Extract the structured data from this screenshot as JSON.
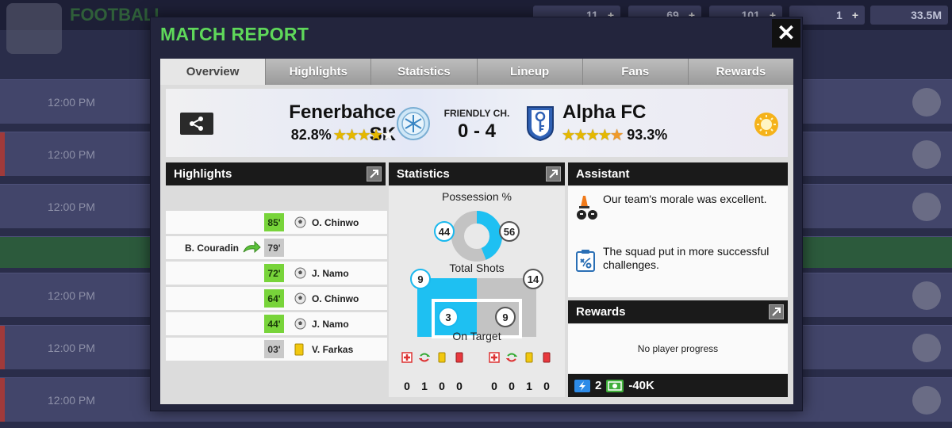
{
  "background": {
    "title": "FOOTBALL",
    "resources": [
      {
        "value": "11"
      },
      {
        "value": "69"
      },
      {
        "value": "101"
      },
      {
        "value": "1"
      },
      {
        "value": "33.5M"
      }
    ],
    "rows": [
      "12:00 PM",
      "12:00 PM",
      "12:00 PM",
      "12:00 PM",
      "12:00 PM",
      "12:00 PM"
    ]
  },
  "modal": {
    "title": "MATCH REPORT",
    "close_label": "✕"
  },
  "tabs": [
    "Overview",
    "Highlights",
    "Statistics",
    "Lineup",
    "Fans",
    "Rewards"
  ],
  "active_tab": "Overview",
  "match": {
    "home_team": "Fenerbahce SK",
    "home_rating": "82.8%",
    "home_stars": {
      "full": 4,
      "half": 0,
      "empty": 1
    },
    "away_team": "Alpha FC",
    "away_rating": "93.3%",
    "away_stars": {
      "full": 4,
      "half": 1,
      "empty": 0
    },
    "competition": "FRIENDLY CH.",
    "score": "0 - 4",
    "weather_icon": "sun-icon"
  },
  "highlights": {
    "heading": "Highlights",
    "events": [
      {
        "minute": "85'",
        "type": "goal",
        "side": "away",
        "player": "O. Chinwo",
        "icon": "ball-icon"
      },
      {
        "minute": "79'",
        "type": "substitution",
        "side": "home",
        "player": "B. Couradin",
        "icon": "sub-arrow-icon"
      },
      {
        "minute": "72'",
        "type": "goal",
        "side": "away",
        "player": "J. Namo",
        "icon": "ball-icon"
      },
      {
        "minute": "64'",
        "type": "goal",
        "side": "away",
        "player": "O. Chinwo",
        "icon": "ball-icon"
      },
      {
        "minute": "44'",
        "type": "goal",
        "side": "away",
        "player": "J. Namo",
        "icon": "ball-icon"
      },
      {
        "minute": "03'",
        "type": "yellow-card",
        "side": "away",
        "player": "V. Farkas",
        "icon": "yellow-card-icon"
      }
    ]
  },
  "statistics": {
    "heading": "Statistics",
    "possession_label": "Possession %",
    "possession_home": 44,
    "possession_away": 56,
    "shots_label": "Total Shots",
    "shots_home": 9,
    "shots_away": 14,
    "on_target_label": "On Target",
    "on_target_home": 3,
    "on_target_away": 9,
    "discipline_icons": [
      "injury-icon",
      "substitution-icon",
      "yellow-card-icon",
      "red-card-icon"
    ],
    "discipline_home": [
      "0",
      "1",
      "0",
      "0"
    ],
    "discipline_away": [
      "0",
      "0",
      "1",
      "0"
    ],
    "colors": {
      "home": "#1ec0f2",
      "away": "#c3c3c3"
    }
  },
  "assistant": {
    "heading": "Assistant",
    "messages": [
      {
        "icon": "morale-icon",
        "text": "Our team's morale was excellent."
      },
      {
        "icon": "tactics-board-icon",
        "text": "The squad put in more successful challenges."
      }
    ]
  },
  "rewards": {
    "heading": "Rewards",
    "progress_text": "No player progress",
    "energy": "2",
    "money": "-40K"
  }
}
